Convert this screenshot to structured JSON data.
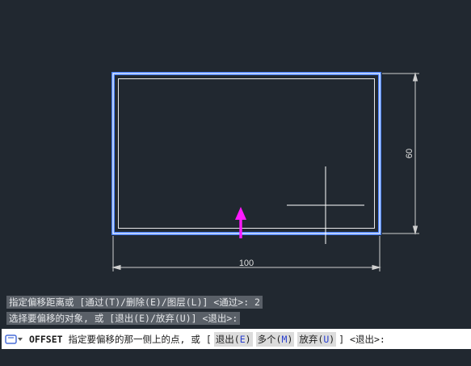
{
  "drawing": {
    "dim_width_label": "100",
    "dim_height_label": "60"
  },
  "history": [
    "指定偏移距离或 [通过(T)/删除(E)/图层(L)] <通过>: 2",
    "选择要偏移的对象, 或 [退出(E)/放弃(U)] <退出>:"
  ],
  "command_line": {
    "command": "OFFSET",
    "prompt": "指定要偏移的那一侧上的点, 或 [",
    "options": [
      {
        "label": "退出(",
        "key": "E",
        "close": ")"
      },
      {
        "label": "多个(",
        "key": "M",
        "close": ")"
      },
      {
        "label": "放弃(",
        "key": "U",
        "close": ")"
      }
    ],
    "suffix": "] <退出>:"
  },
  "colors": {
    "background": "#212830",
    "selected_outline": "#4a82ff",
    "geometry": "#ffffff",
    "dimension": "#d0d0d0",
    "grip": "#ff19ff",
    "option_key": "#2a3fd0"
  },
  "icons": {
    "command_icon": "command-prompt-icon",
    "grip": "arrow-grip-icon",
    "cursor": "crosshair-cursor-icon"
  }
}
